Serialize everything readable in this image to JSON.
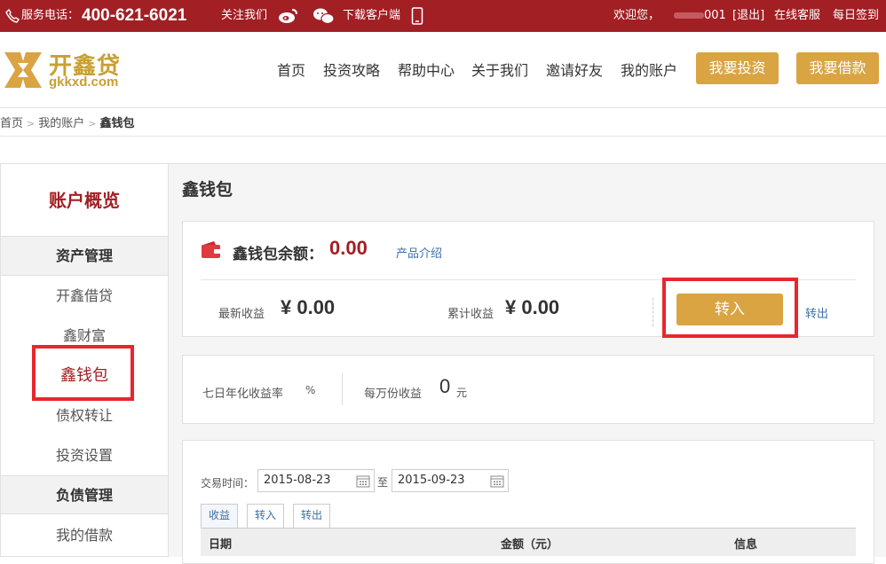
{
  "topbar": {
    "phone_label": "服务电话：",
    "phone_number": "400-621-6021",
    "follow_label": "关注我们",
    "download_label": "下载客户端",
    "welcome": "欢迎您，",
    "username": "001",
    "logout": "[退出]",
    "service": "在线客服",
    "signin": "每日签到"
  },
  "header": {
    "logo_cn": "开鑫贷",
    "logo_en": "gkkxd.com",
    "nav": [
      "首页",
      "投资攻略",
      "帮助中心",
      "关于我们",
      "邀请好友",
      "我的账户"
    ],
    "invest_button": "我要投资",
    "borrow_button": "我要借款"
  },
  "breadcrumb": {
    "home": "首页",
    "account": "我的账户",
    "current": "鑫钱包"
  },
  "sidebar": {
    "title": "账户概览",
    "groups": [
      {
        "label": "资产管理",
        "items": [
          "开鑫借贷",
          "鑫财富",
          "鑫钱包",
          "债权转让",
          "投资设置"
        ]
      },
      {
        "label": "负债管理",
        "items": [
          "我的借款"
        ]
      }
    ],
    "active_item": "鑫钱包"
  },
  "main": {
    "title": "鑫钱包",
    "balance_label": "鑫钱包余额：",
    "balance_value": "0.00",
    "product_intro": "产品介绍",
    "latest_income_label": "最新收益",
    "latest_income_value": "¥ 0.00",
    "total_income_label": "累计收益",
    "total_income_value": "¥ 0.00",
    "transfer_in_button": "转入",
    "transfer_out_link": "转出",
    "annual_rate_label": "七日年化收益率",
    "annual_rate_unit": "%",
    "per_10k_label": "每万份收益",
    "per_10k_value": "0",
    "per_10k_unit": "元",
    "trade_time_label": "交易时间：",
    "date_from": "2015-08-23",
    "date_to_label": "至",
    "date_to": "2015-09-23",
    "tabs": [
      "收益",
      "转入",
      "转出"
    ],
    "table_headers": [
      "日期",
      "金额（元）",
      "信息"
    ]
  },
  "colors": {
    "brand_red": "#a21f24",
    "gold": "#d9a441",
    "highlight_red": "#e8262d"
  }
}
